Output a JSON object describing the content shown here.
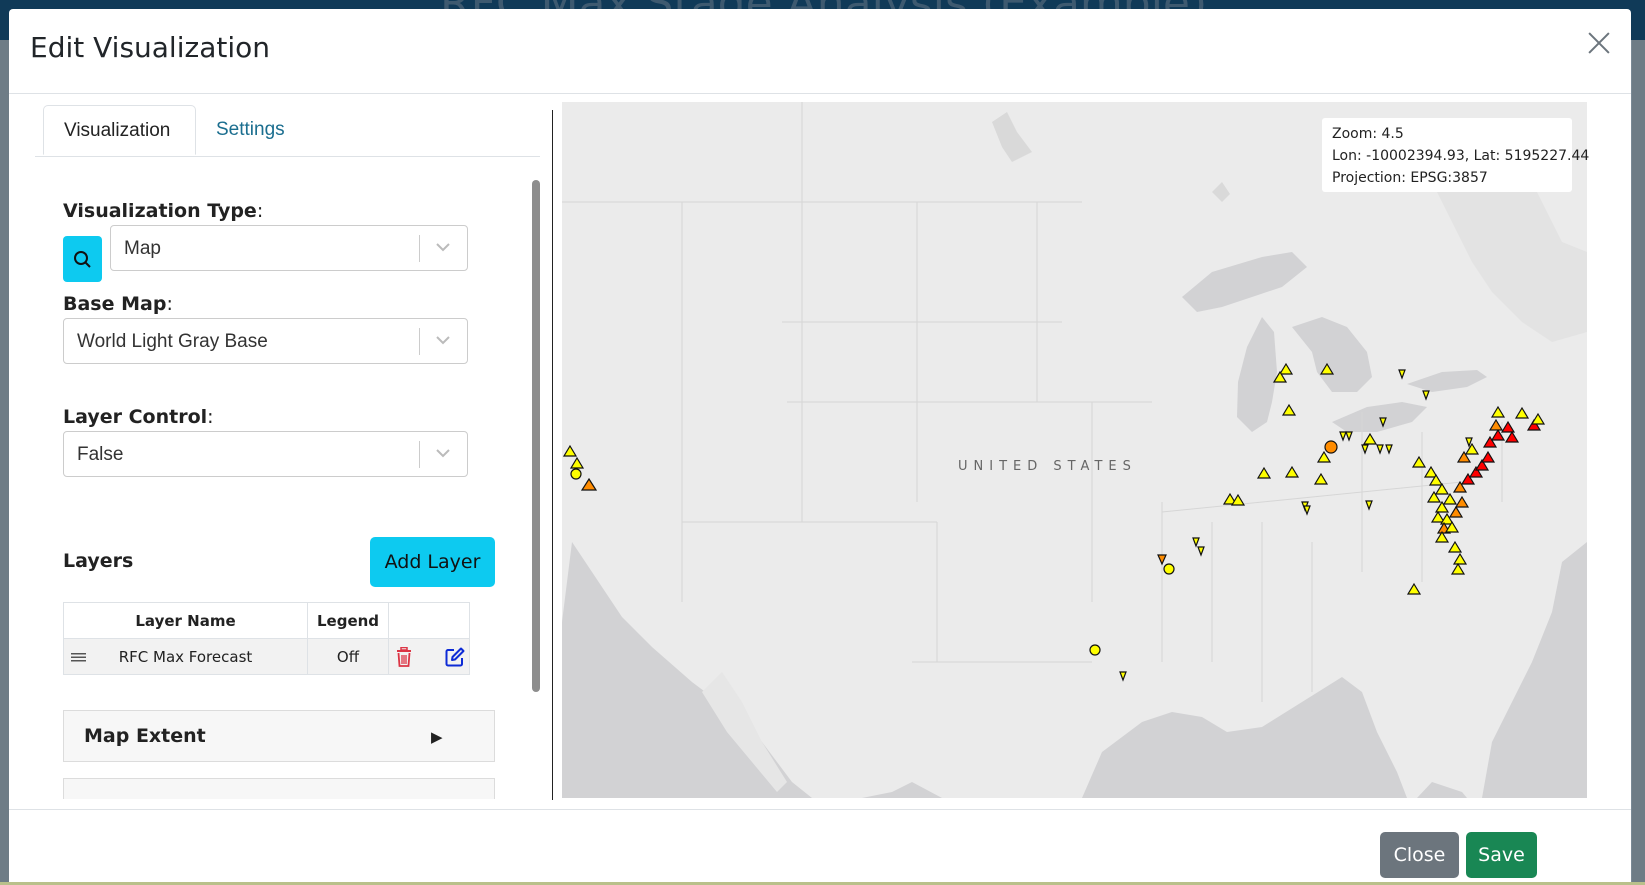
{
  "background": {
    "page_title": "RFC Max Stage Analysis (Example)"
  },
  "modal": {
    "title": "Edit Visualization"
  },
  "tabs": [
    {
      "label": "Visualization"
    },
    {
      "label": "Settings"
    }
  ],
  "visualization_type": {
    "label": "Visualization Type",
    "value": "Map"
  },
  "base_map": {
    "label": "Base Map",
    "value": "World Light Gray Base"
  },
  "layer_control": {
    "label": "Layer Control",
    "value": "False"
  },
  "layers": {
    "title": "Layers",
    "add_label": "Add Layer",
    "columns": [
      "Layer Name",
      "Legend"
    ],
    "rows": [
      {
        "name": "RFC Max Forecast",
        "legend": "Off"
      }
    ]
  },
  "map_extent": {
    "label": "Map Extent"
  },
  "map": {
    "zoom": "Zoom: 4.5",
    "coords": "Lon: -10002394.93, Lat: 5195227.44",
    "projection": "Projection: EPSG:3857",
    "country_label": "UNITED STATES"
  },
  "footer": {
    "close_label": "Close",
    "save_label": "Save"
  },
  "colors": {
    "accent": "#0dcaf0",
    "save": "#198754",
    "close": "#6c757d",
    "marker_yellow": "#ffff00",
    "marker_orange": "#ff8c00",
    "marker_red": "#ff0000"
  }
}
